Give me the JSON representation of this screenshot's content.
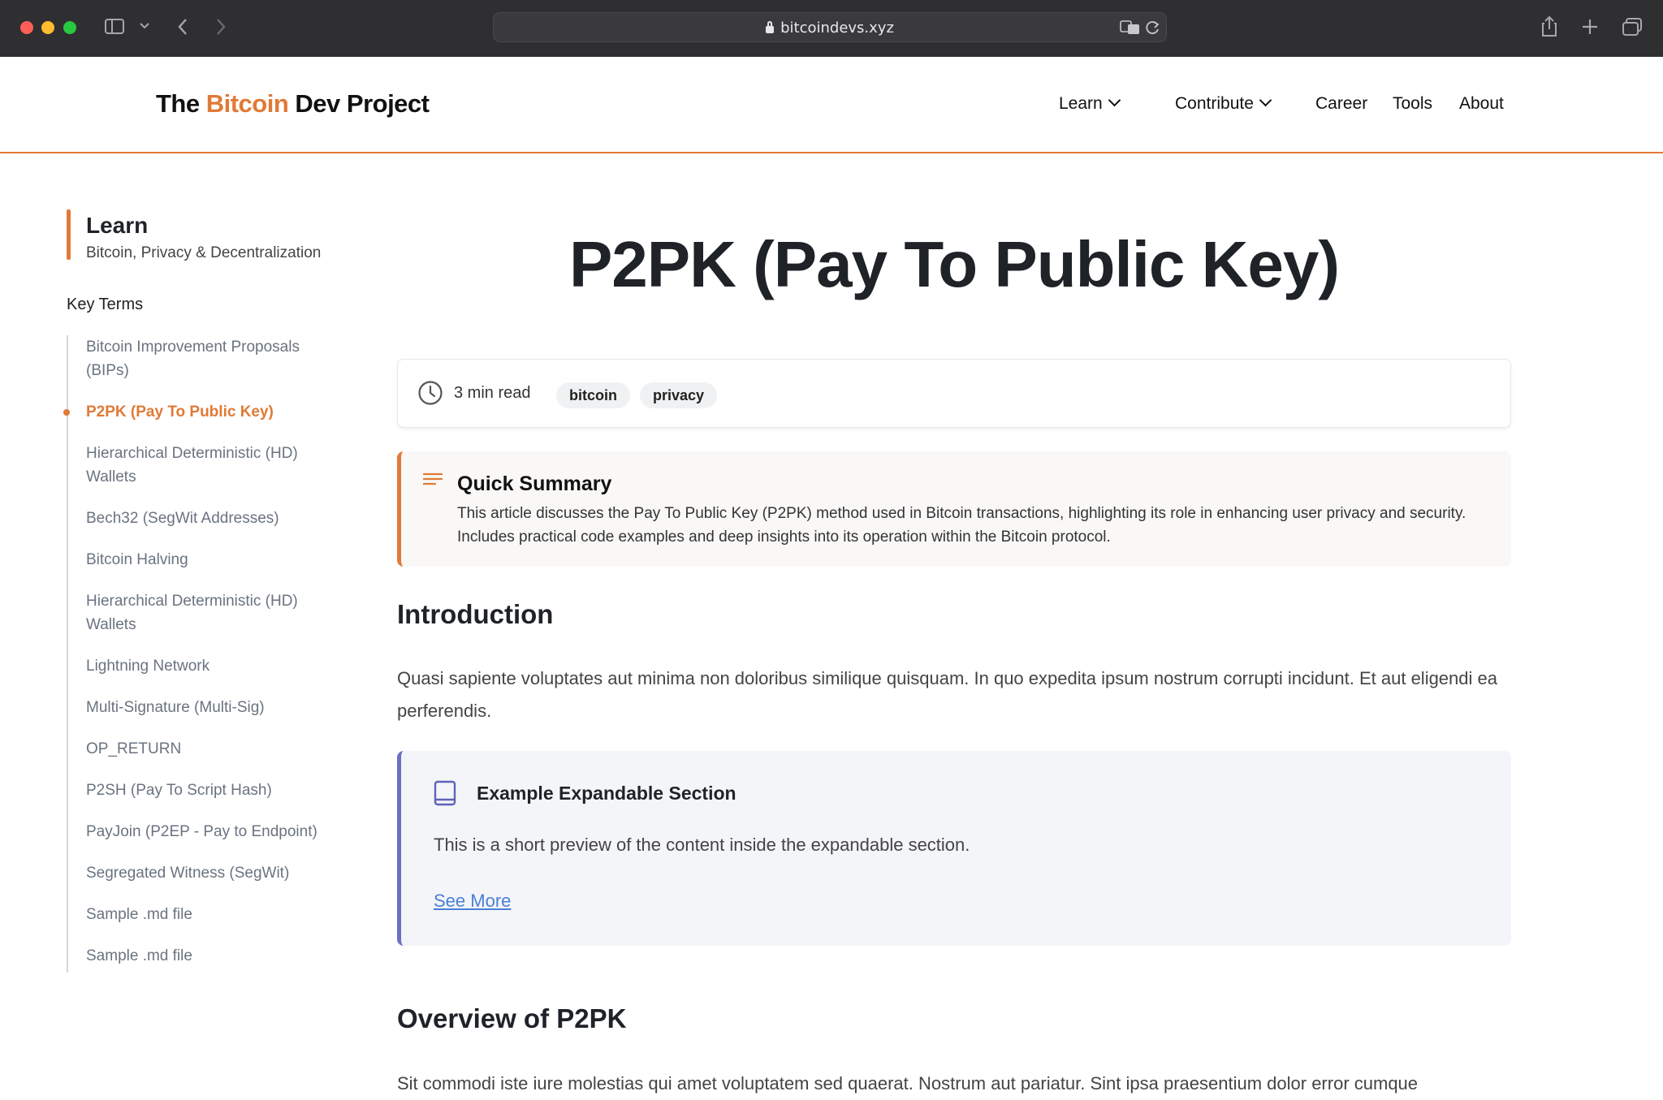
{
  "browser": {
    "url": "bitcoindevs.xyz"
  },
  "header": {
    "logo_prefix": "The ",
    "logo_accent": "Bitcoin",
    "logo_suffix": " Dev Project",
    "nav": {
      "learn": "Learn",
      "contribute": "Contribute",
      "career": "Career",
      "tools": "Tools",
      "about": "About"
    }
  },
  "sidebar": {
    "title": "Learn",
    "subtitle": "Bitcoin, Privacy & Decentralization",
    "heading": "Key Terms",
    "items": [
      "Bitcoin Improvement Proposals (BIPs)",
      "P2PK (Pay To Public Key)",
      "Hierarchical Deterministic (HD) Wallets",
      "Bech32 (SegWit Addresses)",
      "Bitcoin Halving",
      "Hierarchical Deterministic (HD) Wallets",
      "Lightning Network",
      "Multi-Signature (Multi-Sig)",
      "OP_RETURN",
      "P2SH (Pay To Script Hash)",
      "PayJoin (P2EP - Pay to Endpoint)",
      "Segregated Witness (SegWit)",
      "Sample .md file",
      "Sample .md file"
    ],
    "active_index": 1
  },
  "article": {
    "title": "P2PK (Pay To Public Key)",
    "read_time": "3 min read",
    "tags": [
      "bitcoin",
      "privacy"
    ],
    "summary_title": "Quick Summary",
    "summary_text": "This article discusses the Pay To Public Key (P2PK) method used in Bitcoin transactions, highlighting its role in enhancing user privacy and security. Includes practical code examples and deep insights into its operation within the Bitcoin protocol.",
    "intro_heading": "Introduction",
    "intro_text": "Quasi sapiente voluptates aut minima non doloribus similique quisquam. In quo expedita ipsum nostrum corrupti incidunt. Et aut eligendi ea perferendis.",
    "expand_title": "Example Expandable Section",
    "expand_text": "This is a short preview of the content inside the expandable section.",
    "see_more": "See More",
    "overview_heading": "Overview of P2PK",
    "overview_text": "Sit commodi iste iure molestias qui amet voluptatem sed quaerat. Nostrum aut pariatur. Sint ipsa praesentium dolor error cumque"
  },
  "colors": {
    "accent": "#e07a36",
    "expand_border": "#6b6fc7",
    "link": "#4a7fd8"
  }
}
